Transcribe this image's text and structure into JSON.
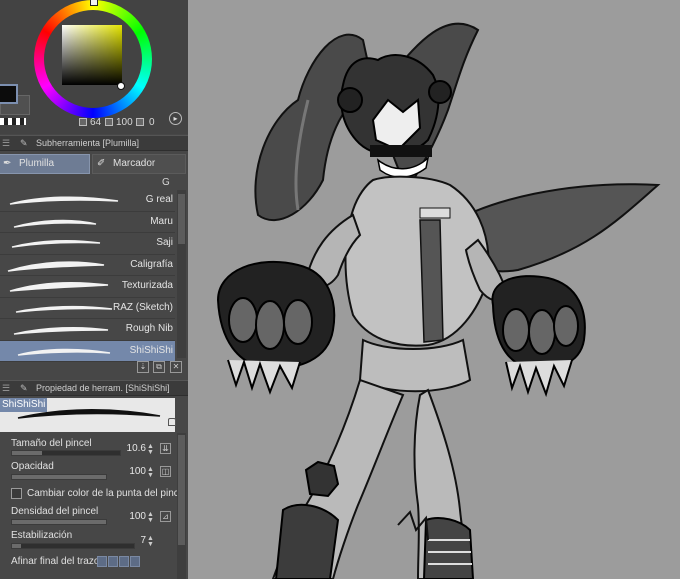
{
  "colors": {
    "accent": "#7488aa",
    "main_color": "#0c0c0c",
    "sub_color": "#505050",
    "canvas_bg": "#9c9c9c",
    "panel_bg": "#474747"
  },
  "color_panel": {
    "size_value": "64",
    "opacity_value": "100",
    "extra_value": "0"
  },
  "subtool_panel": {
    "title": "Subherramienta [Plumilla]",
    "tabs": [
      {
        "label": "Plumilla",
        "icon": "pen-icon",
        "active": true
      },
      {
        "label": "Marcador",
        "icon": "marker-icon",
        "active": false
      }
    ],
    "group_label": "G",
    "brushes": [
      {
        "name": "G real",
        "selected": false
      },
      {
        "name": "Maru",
        "selected": false
      },
      {
        "name": "Saji",
        "selected": false
      },
      {
        "name": "Caligrafía",
        "selected": false
      },
      {
        "name": "Texturizada",
        "selected": false
      },
      {
        "name": "RAZ (Sketch)",
        "selected": false
      },
      {
        "name": "Rough Nib",
        "selected": false
      },
      {
        "name": "ShiShiShi",
        "selected": true
      }
    ]
  },
  "property_panel": {
    "title": "Propiedad de herram. [ShiShiShi]",
    "preview_name": "ShiShiShi",
    "brush_size": {
      "label": "Tamaño del pincel",
      "value": "10.6",
      "fraction": 0.28
    },
    "opacity": {
      "label": "Opacidad",
      "value": "100",
      "fraction": 1.0
    },
    "tip_color_checkbox": {
      "label": "Cambiar color de la punta del pincel",
      "checked": false
    },
    "brush_density": {
      "label": "Densidad del pincel",
      "value": "100",
      "fraction": 1.0
    },
    "stabilization": {
      "label": "Estabilización",
      "value": "7",
      "fraction": 0.07
    },
    "taper": {
      "label": "Afinar final del trazo"
    }
  }
}
